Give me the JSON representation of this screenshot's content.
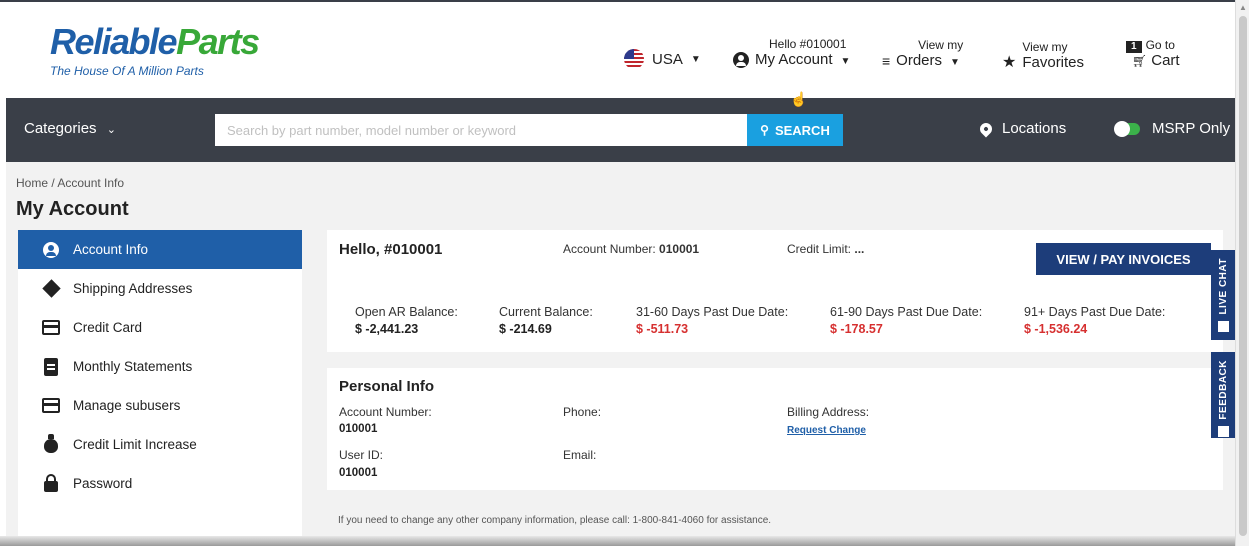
{
  "header": {
    "logo_reliable": "Reliable",
    "logo_parts": "Parts",
    "logo_tagline": "The House Of A Million Parts",
    "country": "USA",
    "account_greeting": "Hello #010001",
    "account_label": "My Account",
    "orders_small": "View my",
    "orders_big": "Orders",
    "fav_small": "View my",
    "fav_big": "Favorites",
    "cart_count": "1",
    "cart_small": "Go to",
    "cart_big": "Cart"
  },
  "nav": {
    "categories": "Categories",
    "search_placeholder": "Search by part number, model number or keyword",
    "search_button": "SEARCH",
    "locations": "Locations",
    "msrp": "MSRP Only"
  },
  "page": {
    "breadcrumb": "Home / Account Info",
    "title": "My Account"
  },
  "sidebar": {
    "items": [
      {
        "label": "Account Info"
      },
      {
        "label": "Shipping Addresses"
      },
      {
        "label": "Credit Card"
      },
      {
        "label": "Monthly Statements"
      },
      {
        "label": "Manage subusers"
      },
      {
        "label": "Credit Limit Increase"
      },
      {
        "label": "Password"
      }
    ]
  },
  "summary": {
    "hello": "Hello, #010001",
    "account_number_label": "Account Number: ",
    "account_number": "010001",
    "credit_limit_label": "Credit Limit: ",
    "credit_limit": "...",
    "pay_button": "VIEW / PAY INVOICES",
    "balances": [
      {
        "label": "Open AR Balance:",
        "value": "$ -2,441.23"
      },
      {
        "label": "Current Balance:",
        "value": "$ -214.69"
      },
      {
        "label": "31-60 Days Past Due Date:",
        "value": "$ -511.73"
      },
      {
        "label": "61-90 Days Past Due Date:",
        "value": "$ -178.57"
      },
      {
        "label": "91+ Days Past Due Date:",
        "value": "$ -1,536.24"
      }
    ]
  },
  "personal": {
    "title": "Personal Info",
    "account_number_label": "Account Number:",
    "account_number": "010001",
    "phone_label": "Phone:",
    "billing_label": "Billing Address:",
    "request_change": "Request Change",
    "user_id_label": "User ID:",
    "user_id": "010001",
    "email_label": "Email:"
  },
  "footer_note": "If you need to change any other company information, please call: 1-800-841-4060 for assistance.",
  "side_tabs": {
    "live_chat": "LIVE CHAT",
    "feedback": "FEEDBACK"
  },
  "colors": {
    "brand_blue": "#1f5fa8",
    "brand_green": "#38a838",
    "nav_dark": "#3a3f48",
    "search_blue": "#1aa0e0",
    "button_navy": "#1d3d7a",
    "past_due_red": "#d63030"
  }
}
